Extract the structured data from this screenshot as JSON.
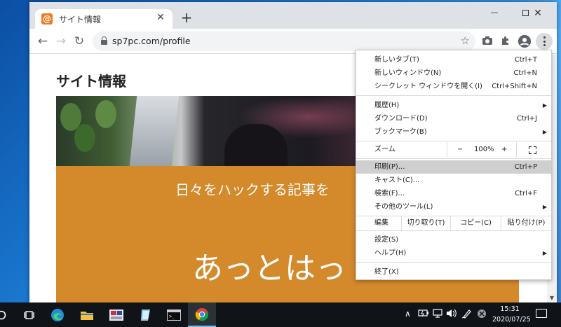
{
  "browser": {
    "tab_title": "サイト情報",
    "tab_favicon": "@",
    "url": "sp7pc.com/profile",
    "newtab_label": "+",
    "close_label": "✕"
  },
  "window_controls": {
    "minimize": "—",
    "maximize": "☐",
    "close": "✕"
  },
  "page": {
    "heading": "サイト情報",
    "tagline": "日々をハックする記事を",
    "name": "あっとはっ"
  },
  "menu": {
    "items_top": [
      {
        "label": "新しいタブ(T)",
        "shortcut": "Ctrl+T"
      },
      {
        "label": "新しいウィンドウ(N)",
        "shortcut": "Ctrl+N"
      },
      {
        "label": "シークレット ウィンドウを開く(I)",
        "shortcut": "Ctrl+Shift+N"
      }
    ],
    "items_history": [
      {
        "label": "履歴(H)",
        "shortcut": "",
        "submenu": "▶"
      },
      {
        "label": "ダウンロード(D)",
        "shortcut": "Ctrl+J",
        "submenu": ""
      },
      {
        "label": "ブックマーク(B)",
        "shortcut": "",
        "submenu": "▶"
      }
    ],
    "zoom": {
      "label": "ズーム",
      "minus": "−",
      "value": "100%",
      "plus": "+"
    },
    "items_print": [
      {
        "label": "印刷(P)...",
        "shortcut": "Ctrl+P",
        "submenu": ""
      },
      {
        "label": "キャスト(C)...",
        "shortcut": "",
        "submenu": ""
      },
      {
        "label": "検索(F)...",
        "shortcut": "Ctrl+F",
        "submenu": ""
      },
      {
        "label": "その他のツール(L)",
        "shortcut": "",
        "submenu": "▶"
      }
    ],
    "edit": {
      "label": "編集",
      "cut": "切り取り(T)",
      "copy": "コピー(C)",
      "paste": "貼り付け(P)"
    },
    "items_settings": [
      {
        "label": "設定(S)",
        "submenu": ""
      },
      {
        "label": "ヘルプ(H)",
        "submenu": "▶"
      }
    ],
    "exit": "終了(X)",
    "highlighted": "印刷(P)..."
  },
  "taskbar": {
    "clock_time": "15:31",
    "clock_date": "2020/07/25",
    "tray_chevron": "∧"
  },
  "colors": {
    "accent_orange": "#d4892b",
    "taskbar": "#101418",
    "menu_highlight": "#cfcfcf"
  }
}
